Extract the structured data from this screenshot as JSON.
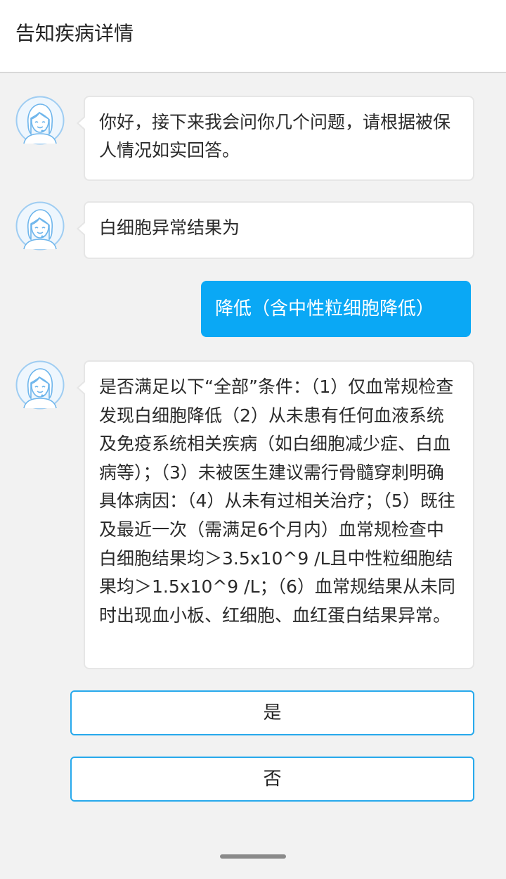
{
  "header": {
    "title": "告知疾病详情"
  },
  "messages": [
    {
      "sender": "bot",
      "text": "你好，接下来我会问你几个问题，请根据被保人情况如实回答。"
    },
    {
      "sender": "bot",
      "text": "白细胞异常结果为"
    },
    {
      "sender": "user",
      "text": "降低（含中性粒细胞降低）"
    },
    {
      "sender": "bot",
      "text": "是否满足以下“全部”条件：（1）仅血常规检查发现白细胞降低（2）从未患有任何血液系统及免疫系统相关疾病（如白细胞减少症、白血病等）；（3）未被医生建议需行骨髓穿刺明确具体病因：（4）从未有过相关治疗；（5）既往及最近一次（需满足6个月内）血常规检查中白细胞结果均＞3.5x10^9 /L且中性粒细胞结果均＞1.5x10^9 /L；（6）血常规结果从未同时出现血小板、红细胞、血红蛋白结果异常。"
    }
  ],
  "options": {
    "yes_label": "是",
    "no_label": "否"
  },
  "icons": {
    "avatar": "customer-service-agent-avatar-icon"
  },
  "colors": {
    "accent": "#0aa8f5",
    "button_border": "#27a9ec",
    "background": "#f2f2f2"
  }
}
